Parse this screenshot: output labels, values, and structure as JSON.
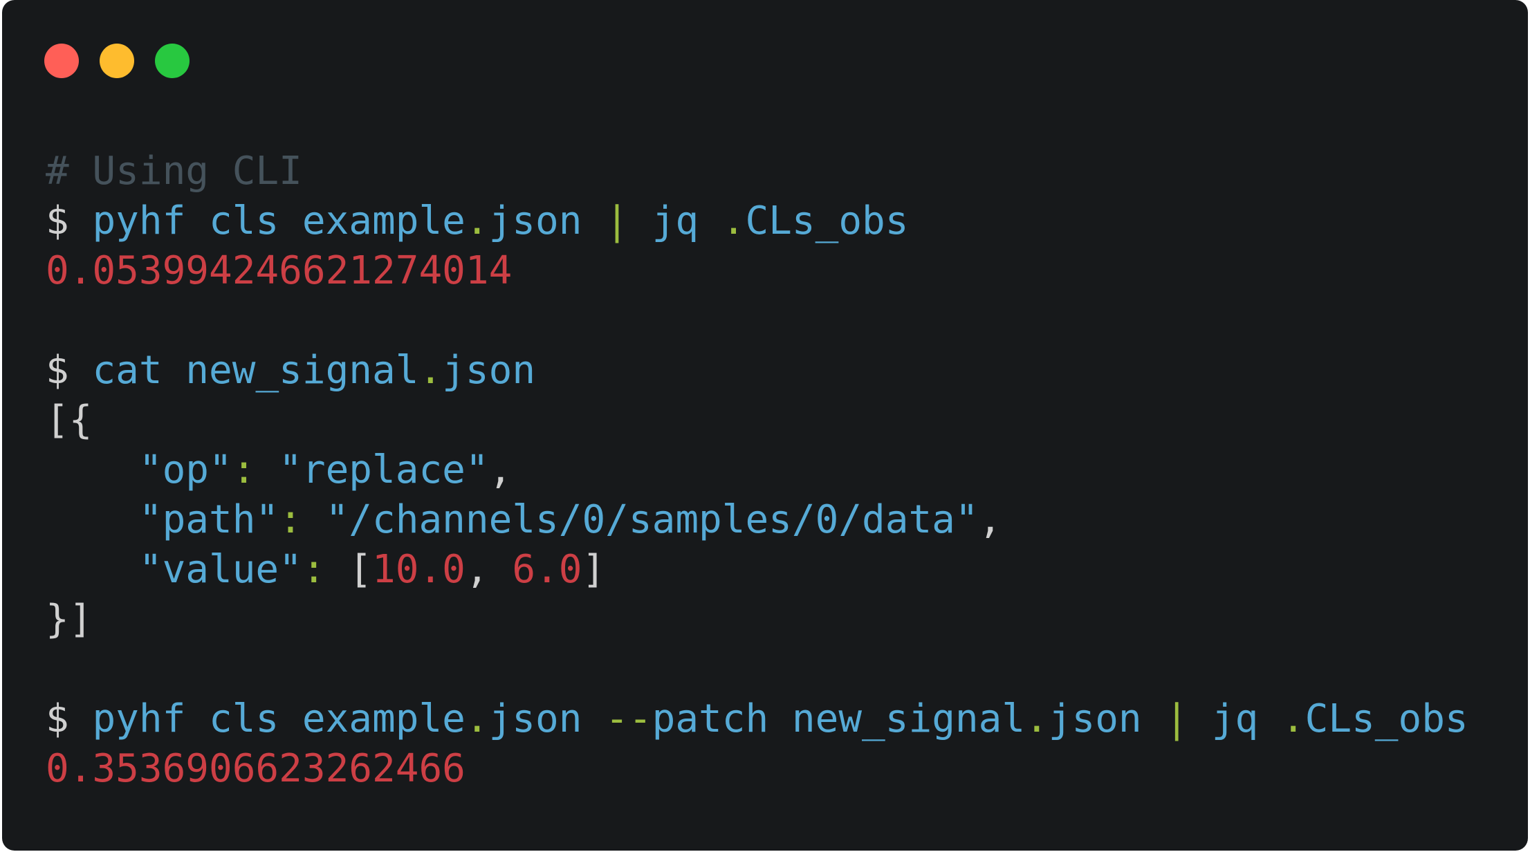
{
  "window": {
    "controls": [
      {
        "name": "close",
        "color": "#ff5f57"
      },
      {
        "name": "minimize",
        "color": "#febc2e"
      },
      {
        "name": "zoom",
        "color": "#28c840"
      }
    ]
  },
  "colors": {
    "comment": "#45525b",
    "prompt": "#d0d0d0",
    "command": "#56aad6",
    "operator": "#9cbd3f",
    "number": "#cd3f45",
    "punctuation": "#d0d0d0"
  },
  "terminal": {
    "lines": [
      [
        {
          "t": "# Using CLI",
          "c": "comment"
        }
      ],
      [
        {
          "t": "$ ",
          "c": "prompt"
        },
        {
          "t": "pyhf cls example",
          "c": "command"
        },
        {
          "t": ".",
          "c": "operator"
        },
        {
          "t": "json ",
          "c": "command"
        },
        {
          "t": "|",
          "c": "operator"
        },
        {
          "t": " jq ",
          "c": "command"
        },
        {
          "t": ".",
          "c": "operator"
        },
        {
          "t": "CLs_obs",
          "c": "command"
        }
      ],
      [
        {
          "t": "0.053994246621274014",
          "c": "number"
        }
      ],
      [],
      [
        {
          "t": "$ ",
          "c": "prompt"
        },
        {
          "t": "cat new_signal",
          "c": "command"
        },
        {
          "t": ".",
          "c": "operator"
        },
        {
          "t": "json",
          "c": "command"
        }
      ],
      [
        {
          "t": "[{",
          "c": "punctuation"
        }
      ],
      [
        {
          "t": "    ",
          "c": "punctuation"
        },
        {
          "t": "\"op\"",
          "c": "command"
        },
        {
          "t": ":",
          "c": "operator"
        },
        {
          "t": " ",
          "c": "punctuation"
        },
        {
          "t": "\"replace\"",
          "c": "command"
        },
        {
          "t": ",",
          "c": "punctuation"
        }
      ],
      [
        {
          "t": "    ",
          "c": "punctuation"
        },
        {
          "t": "\"path\"",
          "c": "command"
        },
        {
          "t": ":",
          "c": "operator"
        },
        {
          "t": " ",
          "c": "punctuation"
        },
        {
          "t": "\"/channels/0/samples/0/data\"",
          "c": "command"
        },
        {
          "t": ",",
          "c": "punctuation"
        }
      ],
      [
        {
          "t": "    ",
          "c": "punctuation"
        },
        {
          "t": "\"value\"",
          "c": "command"
        },
        {
          "t": ":",
          "c": "operator"
        },
        {
          "t": " [",
          "c": "punctuation"
        },
        {
          "t": "10.0",
          "c": "number"
        },
        {
          "t": ", ",
          "c": "punctuation"
        },
        {
          "t": "6.0",
          "c": "number"
        },
        {
          "t": "]",
          "c": "punctuation"
        }
      ],
      [
        {
          "t": "}]",
          "c": "punctuation"
        }
      ],
      [],
      [
        {
          "t": "$ ",
          "c": "prompt"
        },
        {
          "t": "pyhf cls example",
          "c": "command"
        },
        {
          "t": ".",
          "c": "operator"
        },
        {
          "t": "json ",
          "c": "command"
        },
        {
          "t": "--",
          "c": "operator"
        },
        {
          "t": "patch new_signal",
          "c": "command"
        },
        {
          "t": ".",
          "c": "operator"
        },
        {
          "t": "json ",
          "c": "command"
        },
        {
          "t": "|",
          "c": "operator"
        },
        {
          "t": " jq ",
          "c": "command"
        },
        {
          "t": ".",
          "c": "operator"
        },
        {
          "t": "CLs_obs",
          "c": "command"
        }
      ],
      [
        {
          "t": "0.3536906623262466",
          "c": "number"
        }
      ]
    ]
  }
}
